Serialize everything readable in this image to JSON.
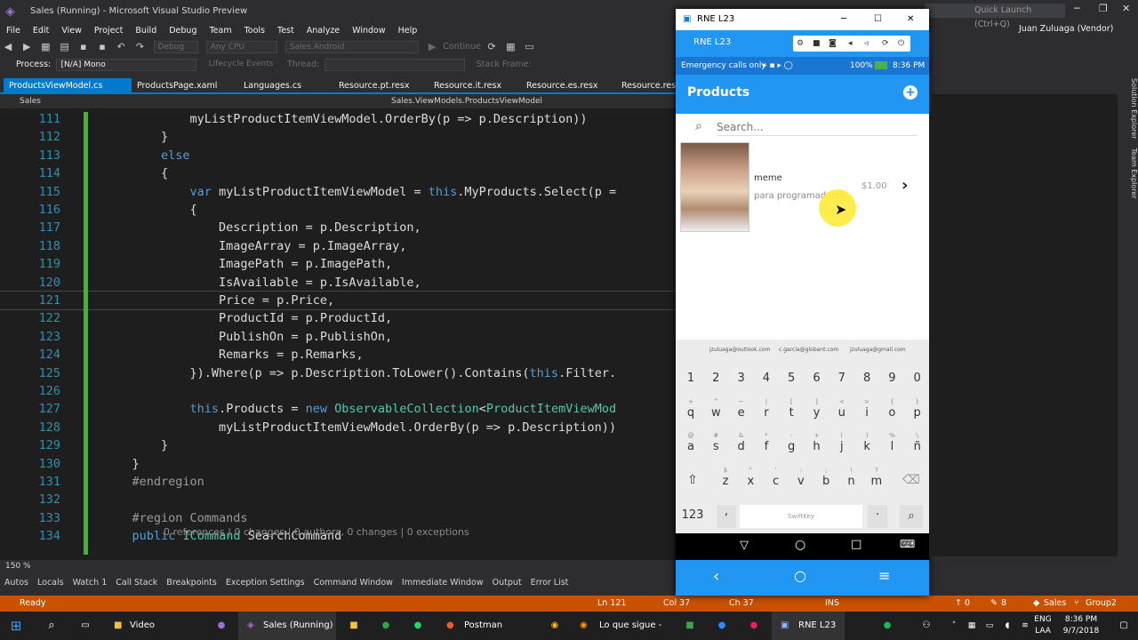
{
  "window": {
    "title": "Sales (Running) - Microsoft Visual Studio Preview",
    "quick_launch": "Quick Launch (Ctrl+Q)",
    "user": "Juan Zuluaga (Vendor)"
  },
  "menu": [
    "File",
    "Edit",
    "View",
    "Project",
    "Build",
    "Debug",
    "Team",
    "Tools",
    "Test",
    "Analyze",
    "Window",
    "Help"
  ],
  "toolbar": {
    "config": "Debug",
    "platform": "Any CPU",
    "project": "Sales.Android",
    "continue": "Continue",
    "process_label": "Process:",
    "process_value": "[N/A] Mono",
    "lifecycle": "Lifecycle Events",
    "thread": "Thread:",
    "stack_frame": "Stack Frame:"
  },
  "tabs": [
    {
      "label": "ProductsViewModel.cs",
      "active": true
    },
    {
      "label": "ProductsPage.xaml",
      "active": false
    },
    {
      "label": "Languages.cs",
      "active": false
    },
    {
      "label": "Resource.pt.resx",
      "active": false
    },
    {
      "label": "Resource.it.resx",
      "active": false
    },
    {
      "label": "Resource.es.resx",
      "active": false
    },
    {
      "label": "Resource.resx",
      "active": false
    }
  ],
  "nav": {
    "project": "Sales",
    "member": "Sales.ViewModels.ProductsViewModel"
  },
  "code": [
    {
      "n": "111",
      "t": "            myListProductItemViewModel.OrderBy(p => p.Description))"
    },
    {
      "n": "112",
      "t": "        }"
    },
    {
      "n": "113",
      "t": "        else"
    },
    {
      "n": "114",
      "t": "        {"
    },
    {
      "n": "115",
      "t": "            var myListProductItemViewModel = this.MyProducts.Select(p ="
    },
    {
      "n": "116",
      "t": "            {"
    },
    {
      "n": "117",
      "t": "                Description = p.Description,"
    },
    {
      "n": "118",
      "t": "                ImageArray = p.ImageArray,"
    },
    {
      "n": "119",
      "t": "                ImagePath = p.ImagePath,"
    },
    {
      "n": "120",
      "t": "                IsAvailable = p.IsAvailable,"
    },
    {
      "n": "121",
      "t": "                Price = p.Price,"
    },
    {
      "n": "122",
      "t": "                ProductId = p.ProductId,"
    },
    {
      "n": "123",
      "t": "                PublishOn = p.PublishOn,"
    },
    {
      "n": "124",
      "t": "                Remarks = p.Remarks,"
    },
    {
      "n": "125",
      "t": "            }).Where(p => p.Description.ToLower().Contains(this.Filter."
    },
    {
      "n": "126",
      "t": ""
    },
    {
      "n": "127",
      "t": "            this.Products = new ObservableCollection<ProductItemViewMod"
    },
    {
      "n": "128",
      "t": "                myListProductItemViewModel.OrderBy(p => p.Description))"
    },
    {
      "n": "129",
      "t": "        }"
    },
    {
      "n": "130",
      "t": "    }"
    },
    {
      "n": "131",
      "t": "    #endregion"
    },
    {
      "n": "132",
      "t": ""
    },
    {
      "n": "133",
      "t": "    #region Commands"
    },
    {
      "n": "134",
      "t": "    public ICommand SearchCommand"
    }
  ],
  "codelens": "0 references | 0 changes | 0 authors, 0 changes | 0 exceptions",
  "zoom": "150 %",
  "bottom_tabs": [
    "Autos",
    "Locals",
    "Watch 1",
    "Call Stack",
    "Breakpoints",
    "Exception Settings",
    "Command Window",
    "Immediate Window",
    "Output",
    "Error List"
  ],
  "status": {
    "ready": "Ready",
    "ln": "Ln 121",
    "col": "Col 37",
    "ch": "Ch 37",
    "ins": "INS",
    "up": "0",
    "pencil": "8",
    "repo": "Sales",
    "branch": "Group2"
  },
  "taskbar": {
    "items": [
      "Video Tutoriales",
      "Sales (Running) ...",
      "Postman",
      "Lo que sigue - ...",
      "RNE L23"
    ],
    "lang": "ENG",
    "lang2": "LAA",
    "time": "8:36 PM",
    "date": "9/7/2018"
  },
  "emulator": {
    "window_title": "RNE L23",
    "device": "RNE L23",
    "status_left": "Emergency calls only",
    "status_right": "100%",
    "status_time": "8:36 PM",
    "page_title": "Products",
    "search_placeholder": "Search...",
    "product": {
      "name": "meme",
      "remarks": "para programadores",
      "price": "$1.00"
    },
    "suggestions": [
      "jzuluaga@outlook.com",
      "c.garcia@globant.com",
      "jzuluaga@gmail.com"
    ],
    "numbers": [
      "1",
      "2",
      "3",
      "4",
      "5",
      "6",
      "7",
      "8",
      "9",
      "0"
    ],
    "row1": [
      "q",
      "w",
      "e",
      "r",
      "t",
      "y",
      "u",
      "i",
      "o",
      "p"
    ],
    "row1_alt": [
      "+",
      "^",
      "~",
      "|",
      "[",
      "]",
      "<",
      ">",
      "{",
      "}"
    ],
    "row2": [
      "a",
      "s",
      "d",
      "f",
      "g",
      "h",
      "j",
      "k",
      "l",
      "ñ"
    ],
    "row2_alt": [
      "@",
      "#",
      "&",
      "*",
      "-",
      "+",
      "(",
      ")",
      "%",
      "\\"
    ],
    "row3": [
      "z",
      "x",
      "c",
      "v",
      "b",
      "n",
      "m"
    ],
    "row3_alt": [
      "$",
      "\"",
      "'",
      ":",
      ";",
      "!",
      "?"
    ],
    "key_123": "123",
    "space": "SwiftKey"
  }
}
